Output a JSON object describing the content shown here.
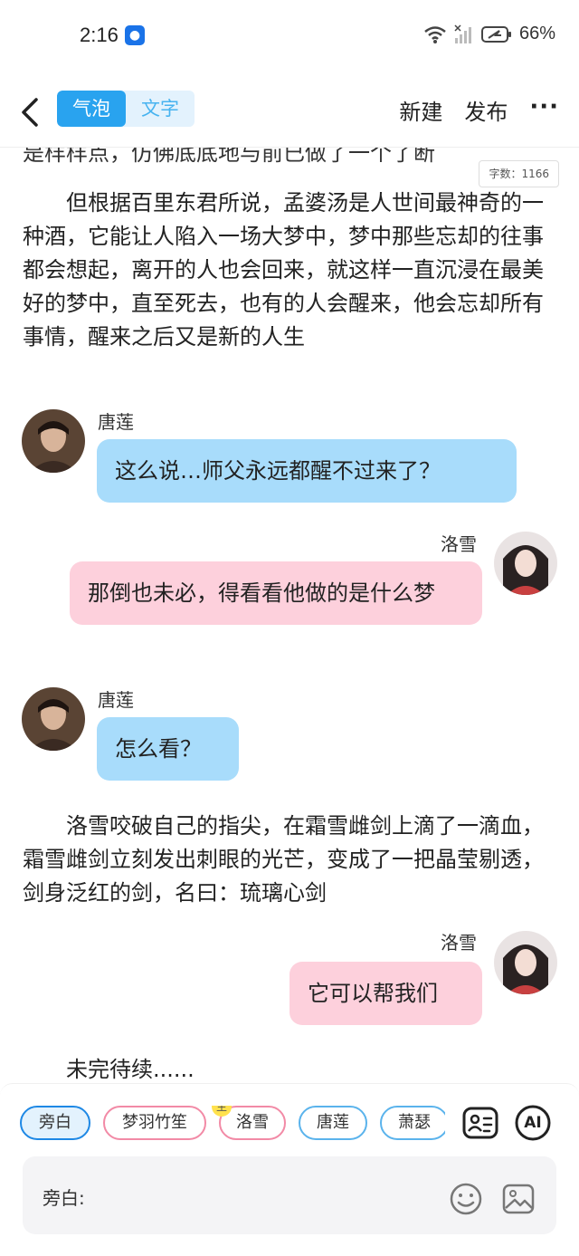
{
  "status_bar": {
    "time": "2:16",
    "battery": "66%"
  },
  "app_bar": {
    "toggle": [
      "气泡",
      "文字"
    ],
    "new_label": "新建",
    "publish_label": "发布",
    "more_label": "···"
  },
  "word_count": "字数：1166",
  "content": {
    "cut_line": "是样样点，仿佛底底地与前已做了一个了断",
    "para1": "但根据百里东君所说，孟婆汤是人世间最神奇的一种酒，它能让人陷入一场大梦中，梦中那些忘却的往事都会想起，离开的人也会回来，就这样一直沉浸在最美好的梦中，直至死去，也有的人会醒来，他会忘却所有事情，醒来之后又是新的人生",
    "msg1": {
      "speaker": "唐莲",
      "text": "这么说…师父永远都醒不过来了？"
    },
    "msg2": {
      "speaker": "洛雪",
      "text": "那倒也未必，得看看他做的是什么梦"
    },
    "msg3": {
      "speaker": "唐莲",
      "text": "怎么看？"
    },
    "para2": "洛雪咬破自己的指尖，在霜雪雌剑上滴了一滴血，霜雪雌剑立刻发出刺眼的光芒，变成了一把晶莹剔透，剑身泛红的剑，名曰：琉璃心剑",
    "msg4": {
      "speaker": "洛雪",
      "text": "它可以帮我们"
    },
    "para3": "未完待续......"
  },
  "characters": {
    "narration": "旁白",
    "c1": "梦羽竹笙",
    "c2": "洛雪",
    "c2_badge": "主",
    "c3": "唐莲",
    "c4": "萧瑟"
  },
  "tools": {
    "ai_label": "AI"
  },
  "input": {
    "label": "旁白:",
    "placeholder": ""
  },
  "colors": {
    "accent": "#29a3ef",
    "left_bubble": "#a8dcfb",
    "right_bubble": "#fdd0dc"
  }
}
